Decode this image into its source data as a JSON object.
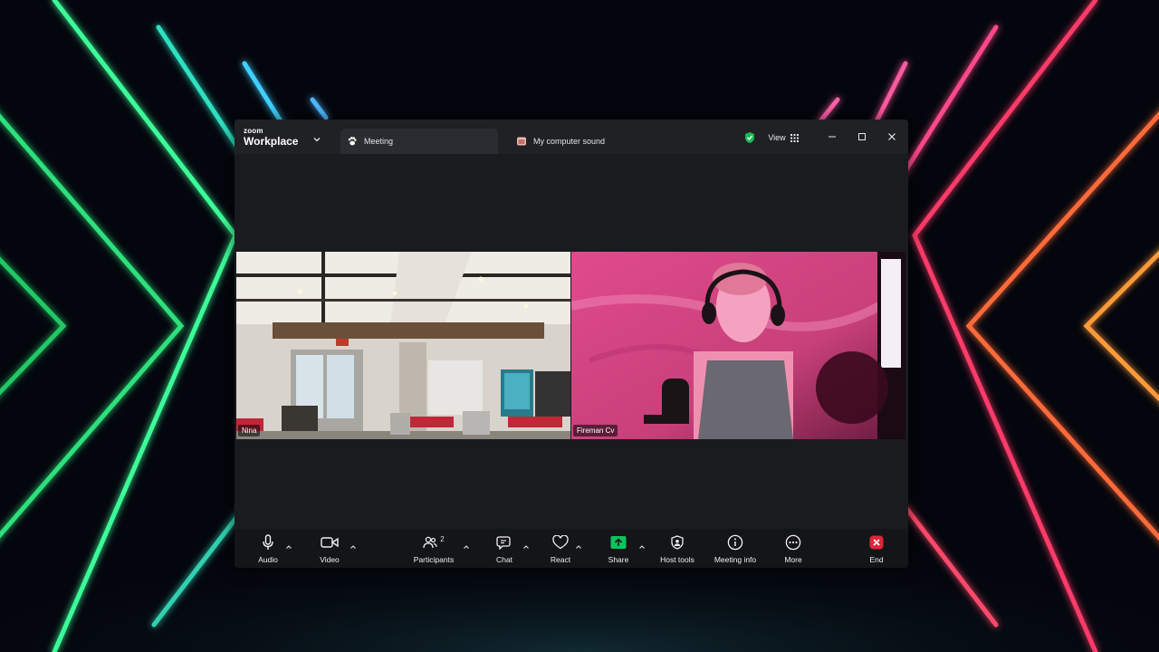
{
  "window": {
    "brand_small": "zoom",
    "brand_name": "Workplace"
  },
  "tabs": [
    {
      "label": "Meeting",
      "icon": "paw-icon"
    },
    {
      "label": "My computer sound",
      "icon": "app-icon"
    }
  ],
  "titlebar": {
    "view_label": "View"
  },
  "participants": [
    {
      "name": "Nina"
    },
    {
      "name": "Fireman Cv"
    }
  ],
  "toolbar": {
    "audio": "Audio",
    "video": "Video",
    "participants": "Participants",
    "participants_count": "2",
    "chat": "Chat",
    "react": "React",
    "share": "Share",
    "host_tools": "Host tools",
    "meeting_info": "Meeting info",
    "more": "More",
    "end": "End"
  },
  "colors": {
    "share_green": "#12c15c",
    "end_red": "#e0243a",
    "shield_green": "#1fb85a"
  }
}
